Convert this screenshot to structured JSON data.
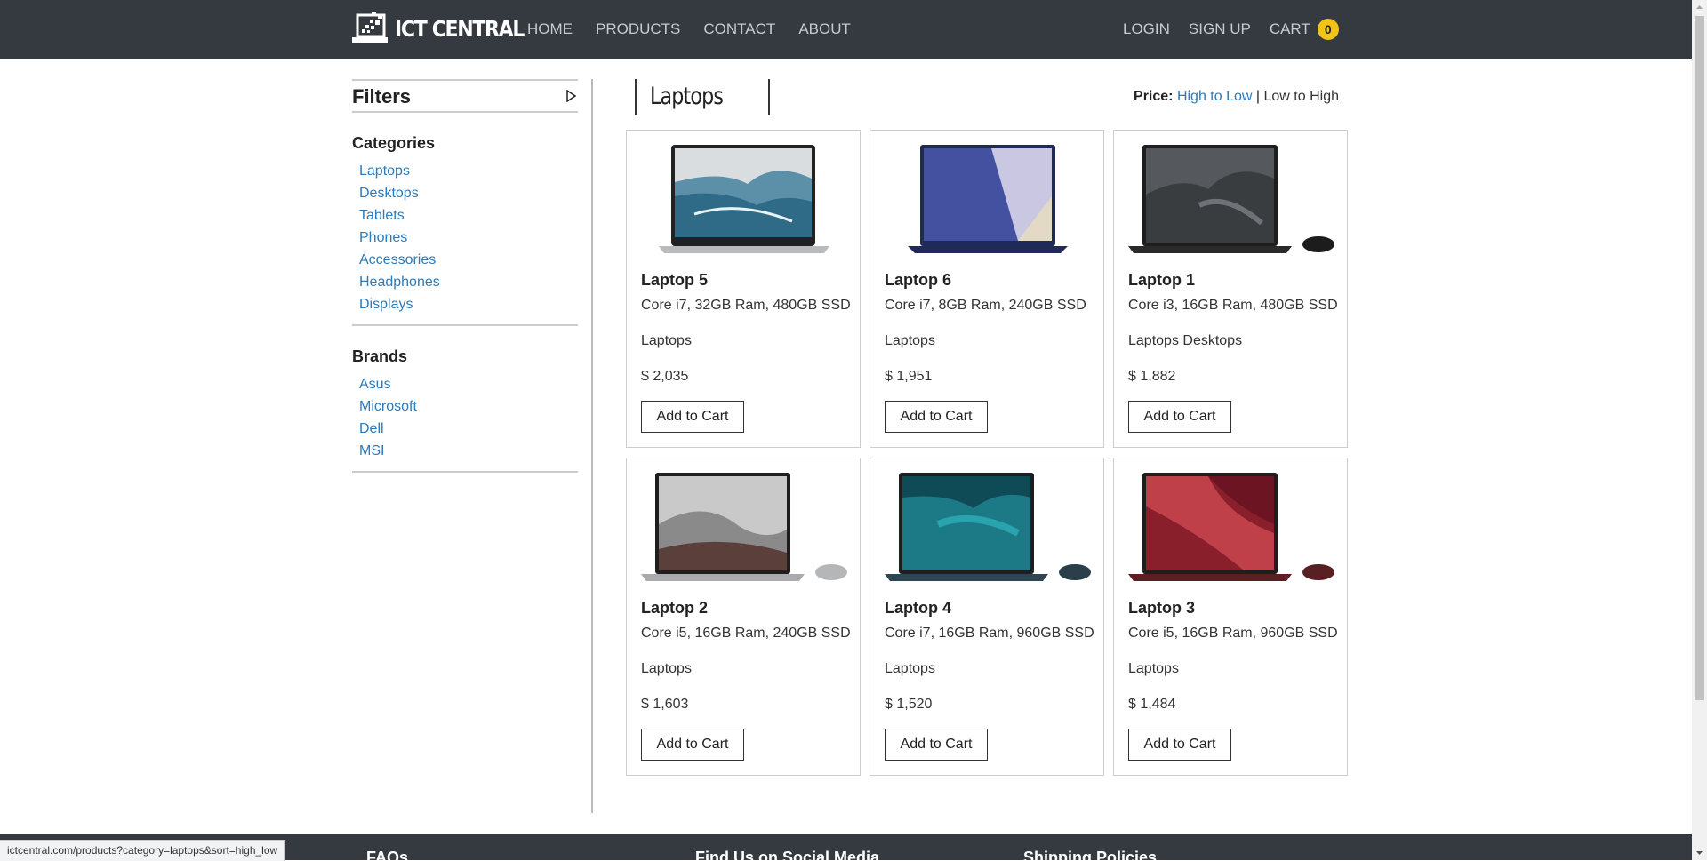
{
  "navbar": {
    "brand": "ICT CENTRAL",
    "links": [
      "HOME",
      "PRODUCTS",
      "CONTACT",
      "ABOUT"
    ],
    "login": "LOGIN",
    "signup": "SIGN UP",
    "cart_label": "CART",
    "cart_count": "0",
    "colors": {
      "bar": "#343a40",
      "badge": "#f2c318"
    }
  },
  "sidebar": {
    "title": "Filters",
    "categories_title": "Categories",
    "categories": [
      "Laptops",
      "Desktops",
      "Tablets",
      "Phones",
      "Accessories",
      "Headphones",
      "Displays"
    ],
    "brands_title": "Brands",
    "brands": [
      "Asus",
      "Microsoft",
      "Dell",
      "MSI"
    ]
  },
  "main": {
    "title": "Laptops",
    "sort_label": "Price:",
    "sort_high_low": "High to Low",
    "sort_separator": "|",
    "sort_low_high": "Low to High",
    "products": [
      {
        "name": "Laptop 5",
        "spec": "Core i7, 32GB Ram, 480GB SSD",
        "category": "Laptops",
        "price": "$ 2,035",
        "button": "Add to Cart",
        "image": "laptop-xps-icon"
      },
      {
        "name": "Laptop 6",
        "spec": "Core i7, 8GB Ram, 240GB SSD",
        "category": "Laptops",
        "price": "$ 1,951",
        "button": "Add to Cart",
        "image": "laptop-zenbook-icon"
      },
      {
        "name": "Laptop 1",
        "spec": "Core i3, 16GB Ram, 480GB SSD",
        "category": "Laptops Desktops",
        "price": "$ 1,882",
        "button": "Add to Cart",
        "image": "laptop-surface-black-icon"
      },
      {
        "name": "Laptop 2",
        "spec": "Core i5, 16GB Ram, 240GB SSD",
        "category": "Laptops",
        "price": "$ 1,603",
        "button": "Add to Cart",
        "image": "laptop-surface-platinum-icon"
      },
      {
        "name": "Laptop 4",
        "spec": "Core i7, 16GB Ram, 960GB SSD",
        "category": "Laptops",
        "price": "$ 1,520",
        "button": "Add to Cart",
        "image": "laptop-surface-blue-icon"
      },
      {
        "name": "Laptop 3",
        "spec": "Core i5, 16GB Ram, 960GB SSD",
        "category": "Laptops",
        "price": "$ 1,484",
        "button": "Add to Cart",
        "image": "laptop-surface-burgundy-icon"
      }
    ]
  },
  "footer": {
    "columns": [
      "FAQs",
      "Find Us on Social Media",
      "Shipping Policies"
    ]
  },
  "status_bar": {
    "url": "ictcentral.com/products?category=laptops&sort=high_low"
  }
}
